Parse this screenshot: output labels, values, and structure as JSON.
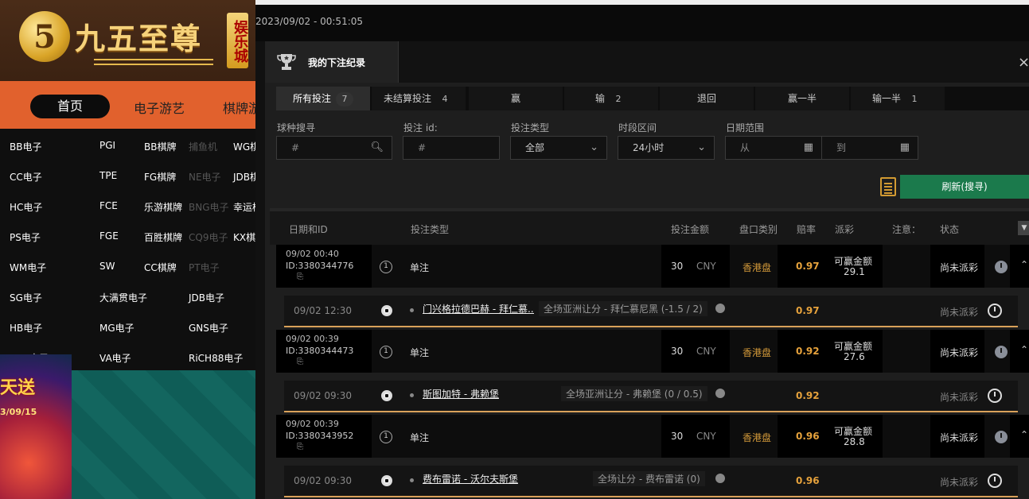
{
  "site": {
    "logo_char": "5",
    "logo_text": "九五至尊",
    "logo_badge": "娱乐城",
    "nav": {
      "home": "首页",
      "item1": "电子游艺",
      "item2": "棋牌游"
    },
    "dropdown_col1": [
      "BB电子",
      "CC电子",
      "HC电子",
      "PS电子",
      "WM电子",
      "SG电子",
      "HB电子",
      "BSG电子"
    ],
    "dropdown_col2": [
      "PGI",
      "TPE",
      "FCE",
      "FGE",
      "SW",
      "大满贯电子",
      "MG电子",
      "VA电子"
    ],
    "dropdown_col3": [
      "BB棋牌",
      "FG棋牌",
      "乐游棋牌",
      "百胜棋牌",
      "CC棋牌",
      "JDB电子",
      "GNS电子",
      "RiCH88电子"
    ],
    "dropdown_faded": [
      "捕鱼机",
      "NE电子",
      "BNG电子",
      "CQ9电子",
      "PT电子"
    ],
    "dropdown_col4": [
      "WG棋",
      "JDB棋",
      "幸运棋",
      "KX棋"
    ],
    "banner_title": "天送",
    "banner_date": "3/09/15"
  },
  "topbar": {
    "datetime": "2023/09/02 - 00:51:05"
  },
  "panel": {
    "title": "我的下注纪录",
    "close": "×",
    "tabs": [
      {
        "label": "所有投注",
        "count": "7"
      },
      {
        "label": "未结算投注",
        "count": "4"
      },
      {
        "label": "赢",
        "count": ""
      },
      {
        "label": "输",
        "count": "2"
      },
      {
        "label": "退回",
        "count": ""
      },
      {
        "label": "赢一半",
        "count": ""
      },
      {
        "label": "输一半",
        "count": "1"
      }
    ],
    "filters": {
      "sport_label": "球种搜寻",
      "sport_ph": "#",
      "id_label": "投注 id:",
      "id_ph": "#",
      "type_label": "投注类型",
      "type_value": "全部",
      "period_label": "时段区间",
      "period_value": "24小时",
      "date_label": "日期范围",
      "date_from": "从",
      "date_to": "到"
    },
    "refresh_label": "刷新(搜寻)",
    "columns": {
      "date": "日期和ID",
      "type": "投注类型",
      "amount": "投注金额",
      "market": "盘口类别",
      "odds": "赔率",
      "payout": "派彩",
      "note": "注意：",
      "status": "状态"
    },
    "bets": [
      {
        "date": "09/02 00:40",
        "id": "ID:3380344776",
        "type": "单注",
        "amount": "30",
        "currency": "CNY",
        "market": "香港盘",
        "odds": "0.97",
        "payout_label": "可赢金额",
        "payout": "29.1",
        "status": "尚未派彩",
        "sub": {
          "time": "09/02 12:30",
          "teams": "门兴格拉德巴赫 - 拜仁慕...",
          "bet": "全场亚洲让分 - 拜仁慕尼黑 (-1.5 / 2)",
          "odds": "0.97",
          "status": "尚未派彩"
        }
      },
      {
        "date": "09/02 00:39",
        "id": "ID:3380344473",
        "type": "单注",
        "amount": "30",
        "currency": "CNY",
        "market": "香港盘",
        "odds": "0.92",
        "payout_label": "可赢金额",
        "payout": "27.6",
        "status": "尚未派彩",
        "sub": {
          "time": "09/02 09:30",
          "teams": "斯图加特 - 弗赖堡",
          "bet": "全场亚洲让分 - 弗赖堡 (0 / 0.5)",
          "odds": "0.92",
          "status": "尚未派彩"
        }
      },
      {
        "date": "09/02 00:39",
        "id": "ID:3380343952",
        "type": "单注",
        "amount": "30",
        "currency": "CNY",
        "market": "香港盘",
        "odds": "0.96",
        "payout_label": "可赢金额",
        "payout": "28.8",
        "status": "尚未派彩",
        "sub": {
          "time": "09/02 09:30",
          "teams": "费布雷诺 - 沃尔夫斯堡",
          "bet": "全场让分 - 费布雷诺 (0)",
          "odds": "0.96",
          "status": "尚未派彩"
        }
      }
    ]
  },
  "colors": {
    "accent_green": "#1b7a4c",
    "odds_orange": "#e6a23c",
    "nav_orange": "#e1612d"
  }
}
